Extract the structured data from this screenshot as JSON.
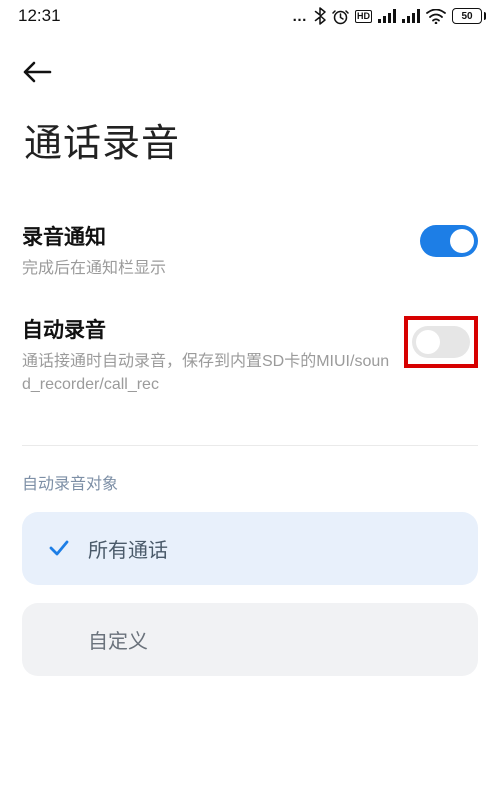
{
  "status": {
    "time": "12:31",
    "hd": "HD",
    "battery": "50"
  },
  "header": {
    "title": "通话录音"
  },
  "settings": {
    "notify": {
      "title": "录音通知",
      "sub": "完成后在通知栏显示",
      "state": "on"
    },
    "auto": {
      "title": "自动录音",
      "sub": "通话接通时自动录音，保存到内置SD卡的MIUI/sound_recorder/call_rec",
      "state": "off"
    }
  },
  "targets": {
    "section_label": "自动录音对象",
    "options": {
      "all": "所有通话",
      "custom": "自定义"
    }
  }
}
